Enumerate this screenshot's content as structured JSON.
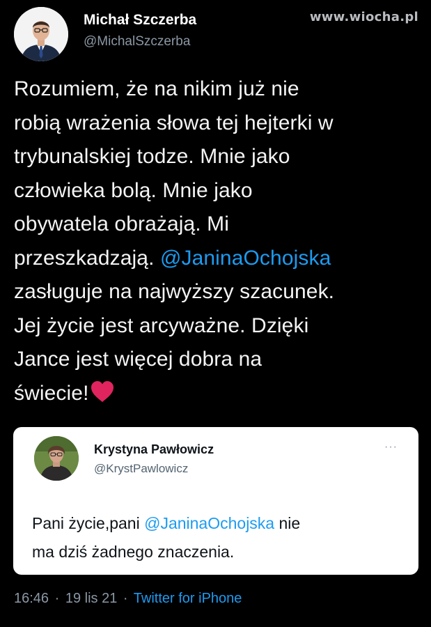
{
  "watermark": "www.wiocha.pl",
  "author": {
    "name": "Michał Szczerba",
    "handle": "@MichalSzczerba"
  },
  "tweet": {
    "lines": [
      "Rozumiem, że na nikim już nie",
      "robią wrażenia słowa tej hejterki w",
      "trybunalskiej todze. Mnie jako",
      "człowieka bolą. Mnie jako",
      "obywatela obrażają. Mi"
    ],
    "line6_prefix": "przeszkadzają. ",
    "mention": "@JaninaOchojska",
    "lines_after": [
      "zasługuje na najwyższy szacunek.",
      "Jej życie jest arcyważne. Dzięki",
      "Jance jest więcej dobra na"
    ],
    "last_line": "świecie!",
    "emoji": "heart"
  },
  "quoted": {
    "name": "Krystyna Pawłowicz",
    "handle": "@KrystPawlowicz",
    "more": "···",
    "text_before": "Pani życie,pani ",
    "mention": "@JaninaOchojska",
    "text_after_line1": " nie",
    "text_line2": "ma dziś żadnego znaczenia."
  },
  "meta": {
    "time": "16:46",
    "date": "19 lis 21",
    "separator": "·",
    "source": "Twitter for iPhone"
  },
  "colors": {
    "background": "#000000",
    "mention": "#1d9bf0",
    "heart": "#e0245e",
    "muted": "#8b98a5"
  }
}
